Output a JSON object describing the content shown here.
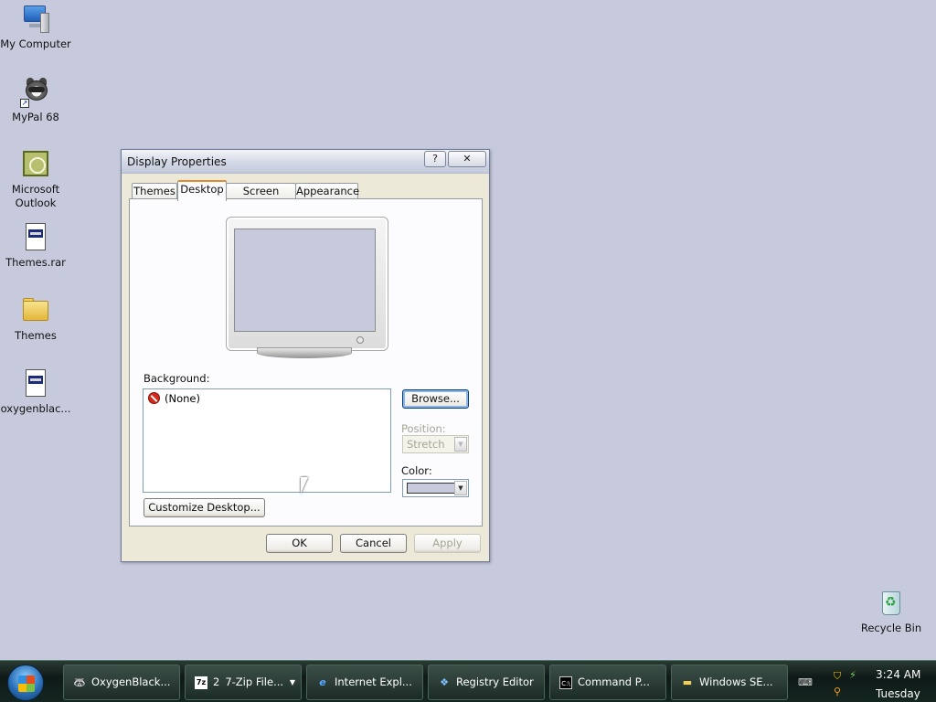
{
  "desktop": {
    "icons": [
      {
        "label": "My Computer",
        "icon": "computer-icon"
      },
      {
        "label": "MyPal 68",
        "icon": "raccoon-browser-icon"
      },
      {
        "label": "Microsoft Outlook",
        "icon": "outlook-icon"
      },
      {
        "label": "Themes.rar",
        "icon": "archive-file-icon"
      },
      {
        "label": "Themes",
        "icon": "folder-icon"
      },
      {
        "label": "oxygenblac...",
        "icon": "archive-file-icon"
      },
      {
        "label": "Recycle Bin",
        "icon": "recycle-bin-icon"
      }
    ],
    "background_color": "#c7cadd"
  },
  "dialog": {
    "title": "Display Properties",
    "help_label": "?",
    "close_label": "✕",
    "tabs": [
      {
        "label": "Themes",
        "active": false
      },
      {
        "label": "Desktop",
        "active": true
      },
      {
        "label": "Screen Saver",
        "active": false
      },
      {
        "label": "Appearance",
        "active": false
      }
    ],
    "background_label": "Background:",
    "background_items": [
      {
        "label": "(None)",
        "icon": "none-prohibited-icon",
        "selected": true
      }
    ],
    "browse_label": "Browse...",
    "position_label": "Position:",
    "position_value": "Stretch",
    "color_label": "Color:",
    "color_value": "#c7cadd",
    "customize_label": "Customize Desktop...",
    "ok_label": "OK",
    "cancel_label": "Cancel",
    "apply_label": "Apply"
  },
  "taskbar": {
    "items": [
      {
        "label": "OxygenBlack...",
        "icon": "raccoon-browser-icon"
      },
      {
        "label": "7-Zip File...",
        "icon": "7zip-icon",
        "badge": "2",
        "has_dropdown": true
      },
      {
        "label": "Internet Expl...",
        "icon": "internet-explorer-icon"
      },
      {
        "label": "Registry Editor",
        "icon": "registry-editor-icon"
      },
      {
        "label": "Command P...",
        "icon": "command-prompt-icon"
      },
      {
        "label": "Windows SE...",
        "icon": "folder-icon"
      }
    ],
    "clock": {
      "time": "3:24 AM",
      "day": "Tuesday"
    }
  }
}
